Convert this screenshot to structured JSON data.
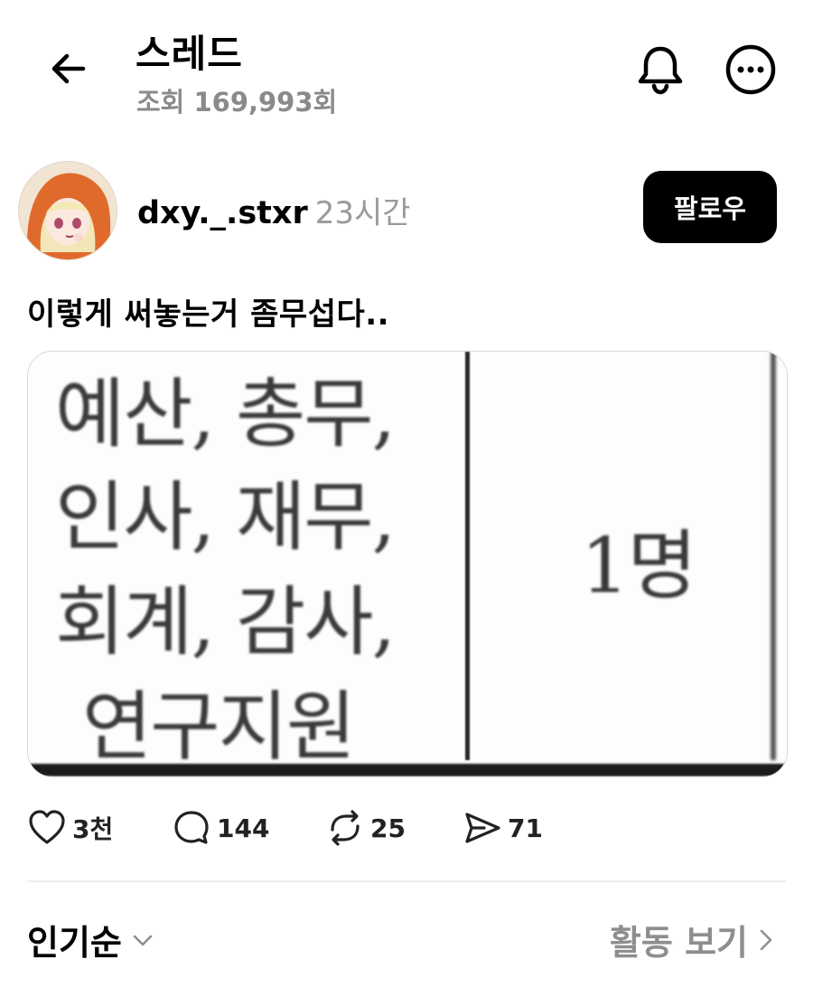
{
  "header": {
    "title": "스레드",
    "views": "조회 169,993회"
  },
  "post": {
    "username": "dxy._.stxr",
    "time_ago": "23시간",
    "follow_label": "팔로우",
    "text": "이렇게 써놓는거 좀무섭다..",
    "image": {
      "lines": [
        "예산, 총무,",
        "인사, 재무,",
        "회계, 감사,",
        "연구지원"
      ],
      "count": "1명"
    },
    "actions": {
      "likes": "3천",
      "comments": "144",
      "reposts": "25",
      "shares": "71"
    }
  },
  "footer": {
    "sort_label": "인기순",
    "activity_label": "활동 보기"
  }
}
